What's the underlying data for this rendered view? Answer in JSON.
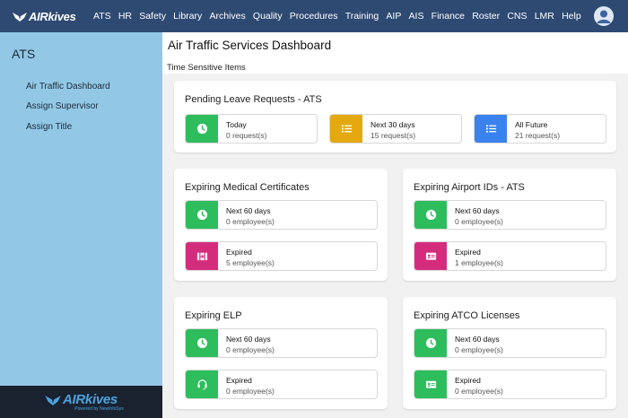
{
  "brand": {
    "logo_text": "AIRkives",
    "footer_logo_text": "AIRkives",
    "footer_sub": "Powered by NewInfoSys"
  },
  "colors": {
    "topbar": "#2e4a73",
    "sidebar": "#92c8e6",
    "green": "#2dbd5c",
    "yellow": "#e3a90f",
    "blue": "#3a82ee",
    "magenta": "#d42c7d"
  },
  "nav": [
    "ATS",
    "HR",
    "Safety",
    "Library",
    "Archives",
    "Quality",
    "Procedures",
    "Training",
    "AIP",
    "AIS",
    "Finance",
    "Roster",
    "CNS",
    "LMR",
    "Help"
  ],
  "sidebar": {
    "title": "ATS",
    "items": [
      "Air Traffic Dashboard",
      "Assign Supervisor",
      "Assign Title"
    ]
  },
  "page": {
    "title": "Air Traffic Services Dashboard",
    "section_label": "Time Sensitive Items"
  },
  "pending": {
    "title": "Pending Leave Requests - ATS",
    "tiles": [
      {
        "title": "Today",
        "sub": "0 request(s)",
        "icon": "clock-icon",
        "color": "green"
      },
      {
        "title": "Next 30 days",
        "sub": "15 request(s)",
        "icon": "list-icon",
        "color": "yellow"
      },
      {
        "title": "All Future",
        "sub": "21 request(s)",
        "icon": "list-icon",
        "color": "blue"
      }
    ]
  },
  "medical": {
    "title": "Expiring Medical Certificates",
    "tiles": [
      {
        "title": "Next 60 days",
        "sub": "0 employee(s)",
        "icon": "clock-icon",
        "color": "green"
      },
      {
        "title": "Expired",
        "sub": "5 employee(s)",
        "icon": "medical-kit-icon",
        "color": "magenta"
      }
    ]
  },
  "airport_ids": {
    "title": "Expiring Airport IDs - ATS",
    "tiles": [
      {
        "title": "Next 60 days",
        "sub": "0 employee(s)",
        "icon": "clock-icon",
        "color": "green"
      },
      {
        "title": "Expired",
        "sub": "1 employee(s)",
        "icon": "id-card-icon",
        "color": "magenta"
      }
    ]
  },
  "elp": {
    "title": "Expiring ELP",
    "tiles": [
      {
        "title": "Next 60 days",
        "sub": "0 employee(s)",
        "icon": "clock-icon",
        "color": "green"
      },
      {
        "title": "Expired",
        "sub": "0 employee(s)",
        "icon": "headset-icon",
        "color": "green"
      }
    ]
  },
  "atco": {
    "title": "Expiring ATCO Licenses",
    "tiles": [
      {
        "title": "Next 60 days",
        "sub": "0 employee(s)",
        "icon": "clock-icon",
        "color": "green"
      },
      {
        "title": "Expired",
        "sub": "0 employee(s)",
        "icon": "id-card-icon",
        "color": "green"
      }
    ]
  }
}
